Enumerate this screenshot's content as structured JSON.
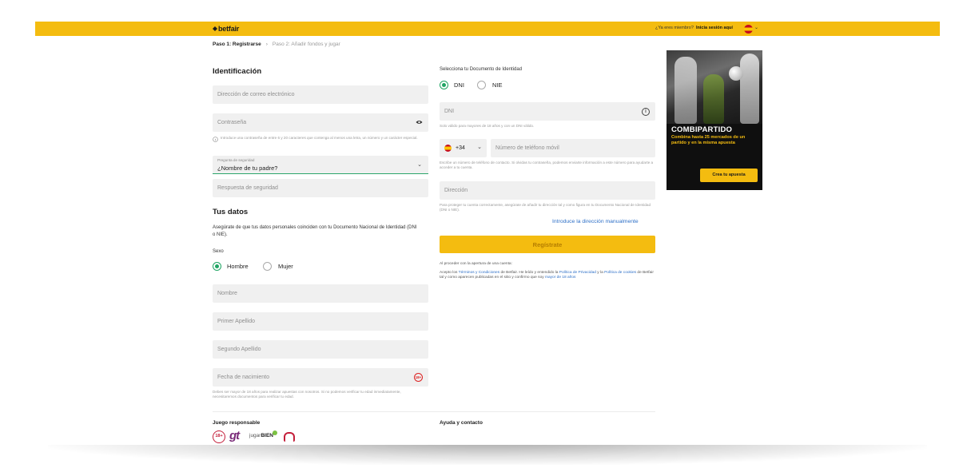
{
  "header": {
    "logo": "betfair",
    "login_question": "¿Ya eres miembro?",
    "login_link": "Inicia sesión aquí"
  },
  "steps": {
    "current": "Paso 1: Registrarse",
    "next": "Paso 2: Añadir fondos y jugar"
  },
  "identificacion": {
    "title": "Identificación",
    "email_placeholder": "Dirección de correo electrónico",
    "password_placeholder": "Contraseña",
    "password_help": "Introduce una contraseña de entre 6 y 20 caracteres que contenga al menos una letra, un número y un carácter especial.",
    "security_question_label": "Pregunta de seguridad",
    "security_question_value": "¿Nombre de tu padre?",
    "security_answer_placeholder": "Respuesta de seguridad"
  },
  "tus_datos": {
    "title": "Tus datos",
    "intro": "Asegúrate de que tus datos personales coinciden con tu Documento Nacional de Identidad (DNI o NIE).",
    "sexo_label": "Sexo",
    "sexo_options": [
      "Hombre",
      "Mujer"
    ],
    "sexo_selected": "Hombre",
    "nombre_placeholder": "Nombre",
    "apellido1_placeholder": "Primer Apellido",
    "apellido2_placeholder": "Segundo Apellido",
    "fecha_placeholder": "Fecha de nacimiento",
    "age_badge": "18+",
    "fecha_help": "Debes ser mayor de 18 años para realizar apuestas con nosotros. Si no podemos verificar tu edad inmediatamente, necesitaremos documentos para verificar tu edad."
  },
  "documento": {
    "label": "Selecciona tu Documento de Identidad",
    "options": [
      "DNI",
      "NIE"
    ],
    "selected": "DNI",
    "dni_placeholder": "DNI",
    "dni_help": "Solo válido para mayores de 18 años y con un DNI válido.",
    "phone_prefix": "+34",
    "phone_placeholder": "Número de teléfono móvil",
    "phone_help": "Escribe un número de teléfono de contacto. Si olvidas tu contraseña, podemos enviarte información a este número para ayudarte a acceder a tu cuenta.",
    "address_placeholder": "Dirección",
    "address_help": "Para proteger tu cuenta correctamente, asegúrate de añadir tu dirección tal y como figura en tu Documento Nacional de Identidad (DNI o NIE).",
    "manual_address_link": "Introduce la dirección manualmente",
    "register_button": "Regístrate",
    "legal_intro": "Al proceder con la apertura de una cuenta:",
    "legal_a": "Acepto los ",
    "legal_terms": "Términos y Condiciones",
    "legal_b": " de Betfair. He leído y entendido la ",
    "legal_privacy": "Política de Privacidad",
    "legal_c": " y la ",
    "legal_cookies": "Política de cookies",
    "legal_d": " de Betfair tal y como aparecen publicadas en el sitio y confirmo que soy ",
    "legal_age": "mayor de 18 años"
  },
  "banner": {
    "title": "COMBIPARTIDO",
    "subtitle": "Combina hasta 25 mercados de un partido y en la misma apuesta",
    "button": "Crea tu apuesta"
  },
  "footer": {
    "responsible_title": "Juego responsable",
    "help_title": "Ayuda y contacto",
    "age_badge": "18+",
    "gt_logo": "gt",
    "jugar_bien_a": "jugar",
    "jugar_bien_b": "BIEN"
  },
  "colors": {
    "brand_yellow": "#f4bc10",
    "accent_green": "#1fa463",
    "link_blue": "#2d6fc7"
  }
}
